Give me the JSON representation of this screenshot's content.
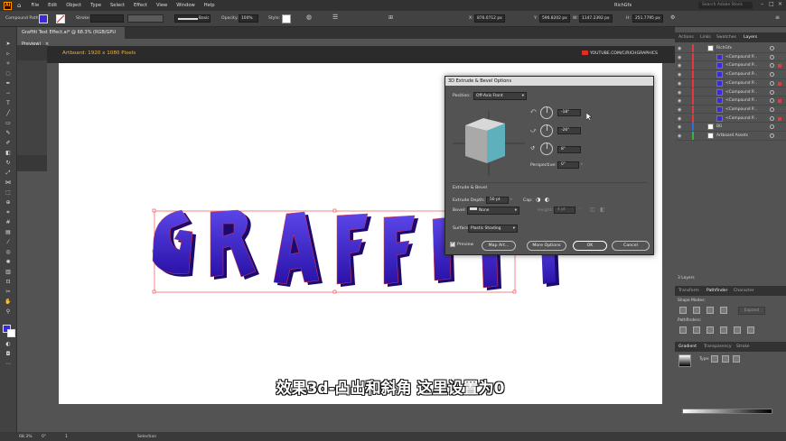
{
  "menubar": {
    "logo": "Ai",
    "items": [
      "File",
      "Edit",
      "Object",
      "Type",
      "Select",
      "Effect",
      "View",
      "Window",
      "Help"
    ],
    "workspace": "RichGfx",
    "search_placeholder": "Search Adobe Stock"
  },
  "control_bar": {
    "selection_type": "Compound Path",
    "stroke_label": "Stroke:",
    "brush_label": "Basic",
    "opacity_label": "Opacity:",
    "opacity_value": "100%",
    "style_label": "Style:",
    "x_value": "876.0712 px",
    "y_value": "596.8202 px",
    "w_value": "1147.2392 px",
    "h_value": "251.7795 px"
  },
  "document_tab": {
    "title": "Graffiti Text Effect.ai* @ 68.3% (RGB/GPU Preview)",
    "close": "×"
  },
  "artboard_label": "Artboard: 1920 x 1080 Pixels",
  "watermark": "YOUTUBE.COM/C/RICHGRAPHICS",
  "artwork_text": "GRAFFITI",
  "subtitle": "效果3d-凸出和斜角  这里设置为0",
  "dialog": {
    "title": "3D Extrude & Bevel Options",
    "position_label": "Position:",
    "position_value": "Off-Axis Front",
    "rot_x": "-18°",
    "rot_y": "-26°",
    "rot_z": "8°",
    "perspective_label": "Perspective:",
    "perspective_value": "0°",
    "section_label": "Extrude & Bevel",
    "extrude_label": "Extrude Depth:",
    "extrude_value": "50 pt",
    "cap_label": "Cap:",
    "bevel_label": "Bevel:",
    "bevel_value": "None",
    "height_label": "Height:",
    "height_value": "4 pt",
    "surface_label": "Surface:",
    "surface_value": "Plastic Shading",
    "preview_label": "Preview",
    "map_art": "Map Art...",
    "more_options": "More Options",
    "ok": "OK",
    "cancel": "Cancel"
  },
  "panels": {
    "top_tabs": [
      "Actions",
      "Links",
      "Swatches",
      "Layers"
    ],
    "layers": [
      {
        "name": "RichGfx",
        "level": 0
      },
      {
        "name": "<Compound P...",
        "level": 1
      },
      {
        "name": "<Compound P...",
        "level": 1
      },
      {
        "name": "<Compound P...",
        "level": 1
      },
      {
        "name": "<Compound P...",
        "level": 1
      },
      {
        "name": "<Compound P...",
        "level": 1
      },
      {
        "name": "<Compound P...",
        "level": 1
      },
      {
        "name": "<Compound P...",
        "level": 1
      },
      {
        "name": "<Compound P...",
        "level": 1
      },
      {
        "name": "BG",
        "level": 0
      },
      {
        "name": "Artboard Assets",
        "level": 0
      }
    ],
    "layers_count": "3 Layers",
    "mid_tabs": [
      "Transform",
      "Pathfinder",
      "Character"
    ],
    "shape_modes": "Shape Modes:",
    "pathfinders": "Pathfinders:",
    "expand": "Expand",
    "bottom_tabs": [
      "Gradient",
      "Transparency",
      "Stroke"
    ],
    "gradient_type": "Type:"
  },
  "status_bar": {
    "zoom": "68.3%",
    "rotation": "0°",
    "artboard_num": "1",
    "tool": "Selection"
  },
  "colors": {
    "fill": "#3b2bd6",
    "accent_red": "#e8373f",
    "artboard_label": "#f0b23c",
    "letter_main": "#3a1fc4",
    "letter_shadow": "#1c0a70",
    "cube_face": "#5fb0bd"
  }
}
